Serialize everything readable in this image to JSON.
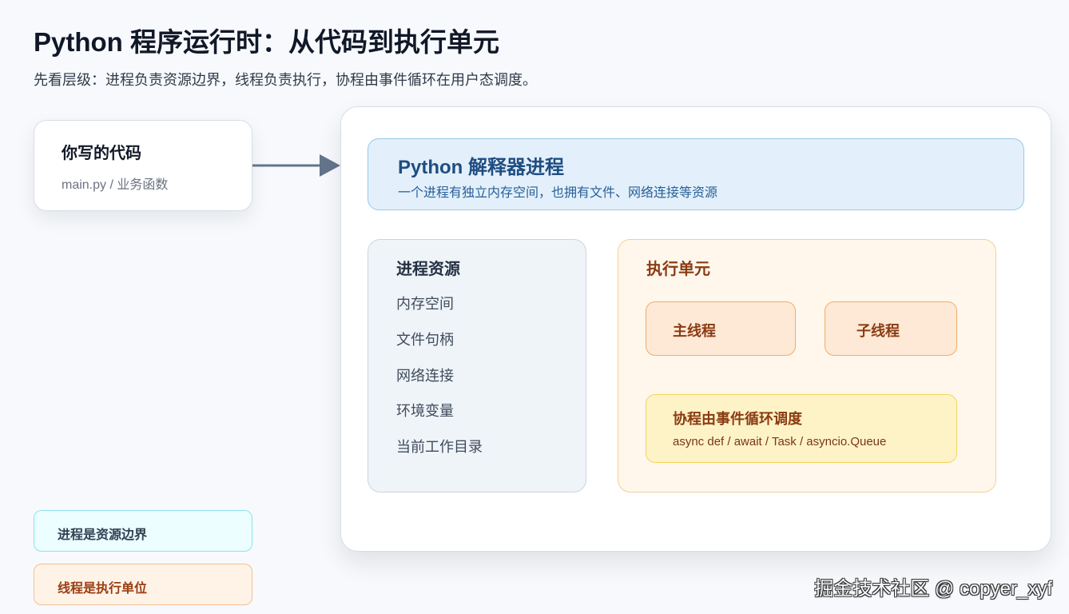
{
  "header": {
    "title": "Python 程序运行时：从代码到执行单元",
    "subtitle": "先看层级：进程负责资源边界，线程负责执行，协程由事件循环在用户态调度。"
  },
  "code_card": {
    "title": "你写的代码",
    "subtitle": "main.py / 业务函数"
  },
  "interpreter": {
    "title": "Python 解释器进程",
    "subtitle": "一个进程有独立内存空间，也拥有文件、网络连接等资源"
  },
  "process_resources": {
    "title": "进程资源",
    "items": [
      "内存空间",
      "文件句柄",
      "网络连接",
      "环境变量",
      "当前工作目录"
    ]
  },
  "execution_units": {
    "title": "执行单元",
    "main_thread": "主线程",
    "child_thread": "子线程",
    "coroutine": {
      "title": "协程由事件循环调度",
      "subtitle": "async def / await / Task / asyncio.Queue"
    }
  },
  "legend": {
    "process": "进程是资源边界",
    "thread": "线程是执行单位"
  },
  "watermark": "掘金技术社区 @ copyer_xyf",
  "colors": {
    "arrow": "#64748b",
    "interpreter_fill": "#e3f0fb",
    "resources_fill": "#eff4f9",
    "execution_fill": "#fff7ec",
    "thread_fill": "#fde9d6",
    "coroutine_fill": "#fef3c7",
    "thread_arrow": "#eea15c"
  }
}
